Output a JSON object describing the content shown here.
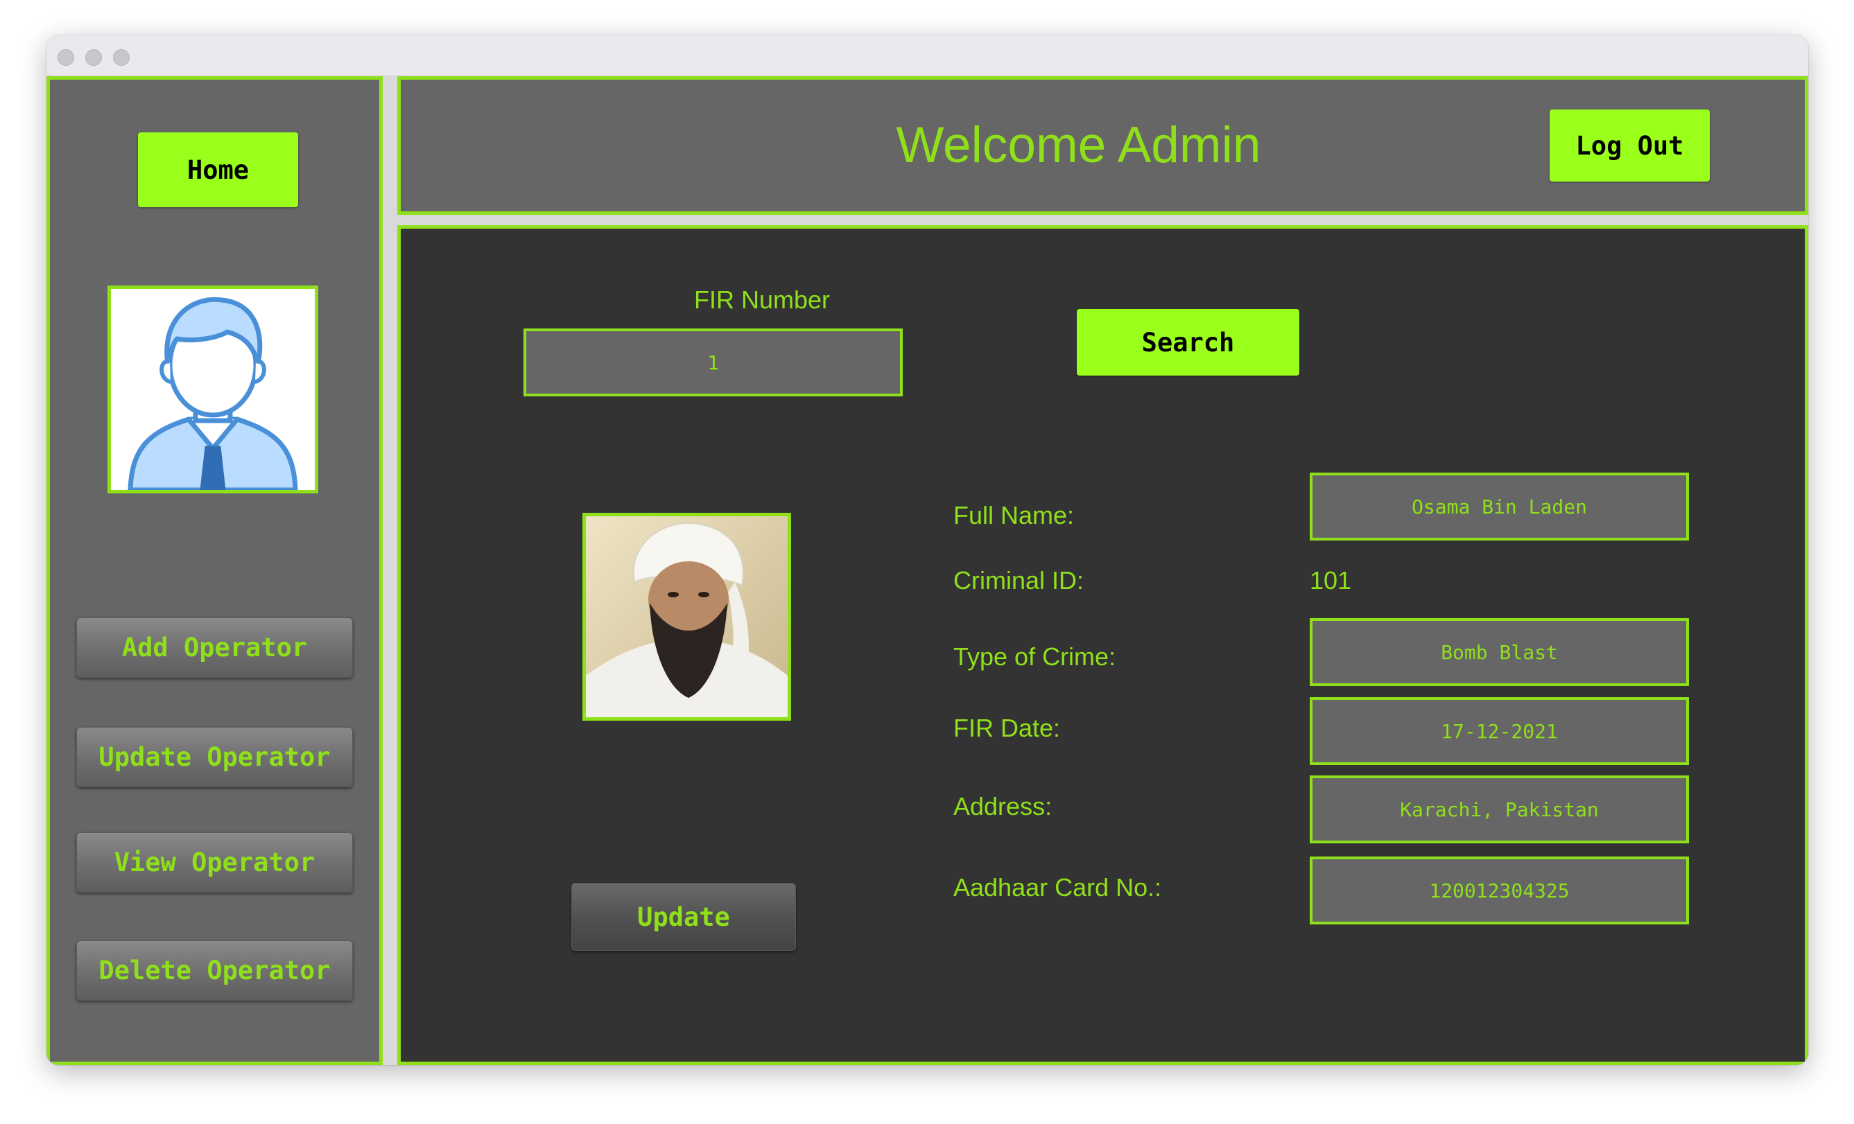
{
  "window": {
    "controls": [
      "close-icon",
      "minimize-icon",
      "zoom-icon"
    ]
  },
  "colors": {
    "accent": "#8fe01a",
    "button_green": "#9aff1a",
    "panel": "#666666",
    "content_bg": "#333333"
  },
  "sidebar": {
    "home_label": "Home",
    "avatar_icon": "user-avatar-icon",
    "items": [
      {
        "label": "Add Operator"
      },
      {
        "label": "Update Operator"
      },
      {
        "label": "View Operator"
      },
      {
        "label": "Delete Operator"
      }
    ]
  },
  "header": {
    "title": "Welcome Admin",
    "logout_label": "Log Out"
  },
  "search": {
    "fir_label": "FIR Number",
    "fir_value": "1",
    "search_label": "Search"
  },
  "record": {
    "photo_icon": "criminal-photo",
    "fields": {
      "full_name_label": "Full Name:",
      "full_name_value": "Osama Bin Laden",
      "criminal_id_label": "Criminal ID:",
      "criminal_id_value": "101",
      "crime_type_label": "Type of Crime:",
      "crime_type_value": "Bomb Blast",
      "fir_date_label": "FIR Date:",
      "fir_date_value": "17-12-2021",
      "address_label": "Address:",
      "address_value": "Karachi, Pakistan",
      "aadhaar_label": "Aadhaar Card No.:",
      "aadhaar_value": "120012304325"
    },
    "update_label": "Update"
  }
}
